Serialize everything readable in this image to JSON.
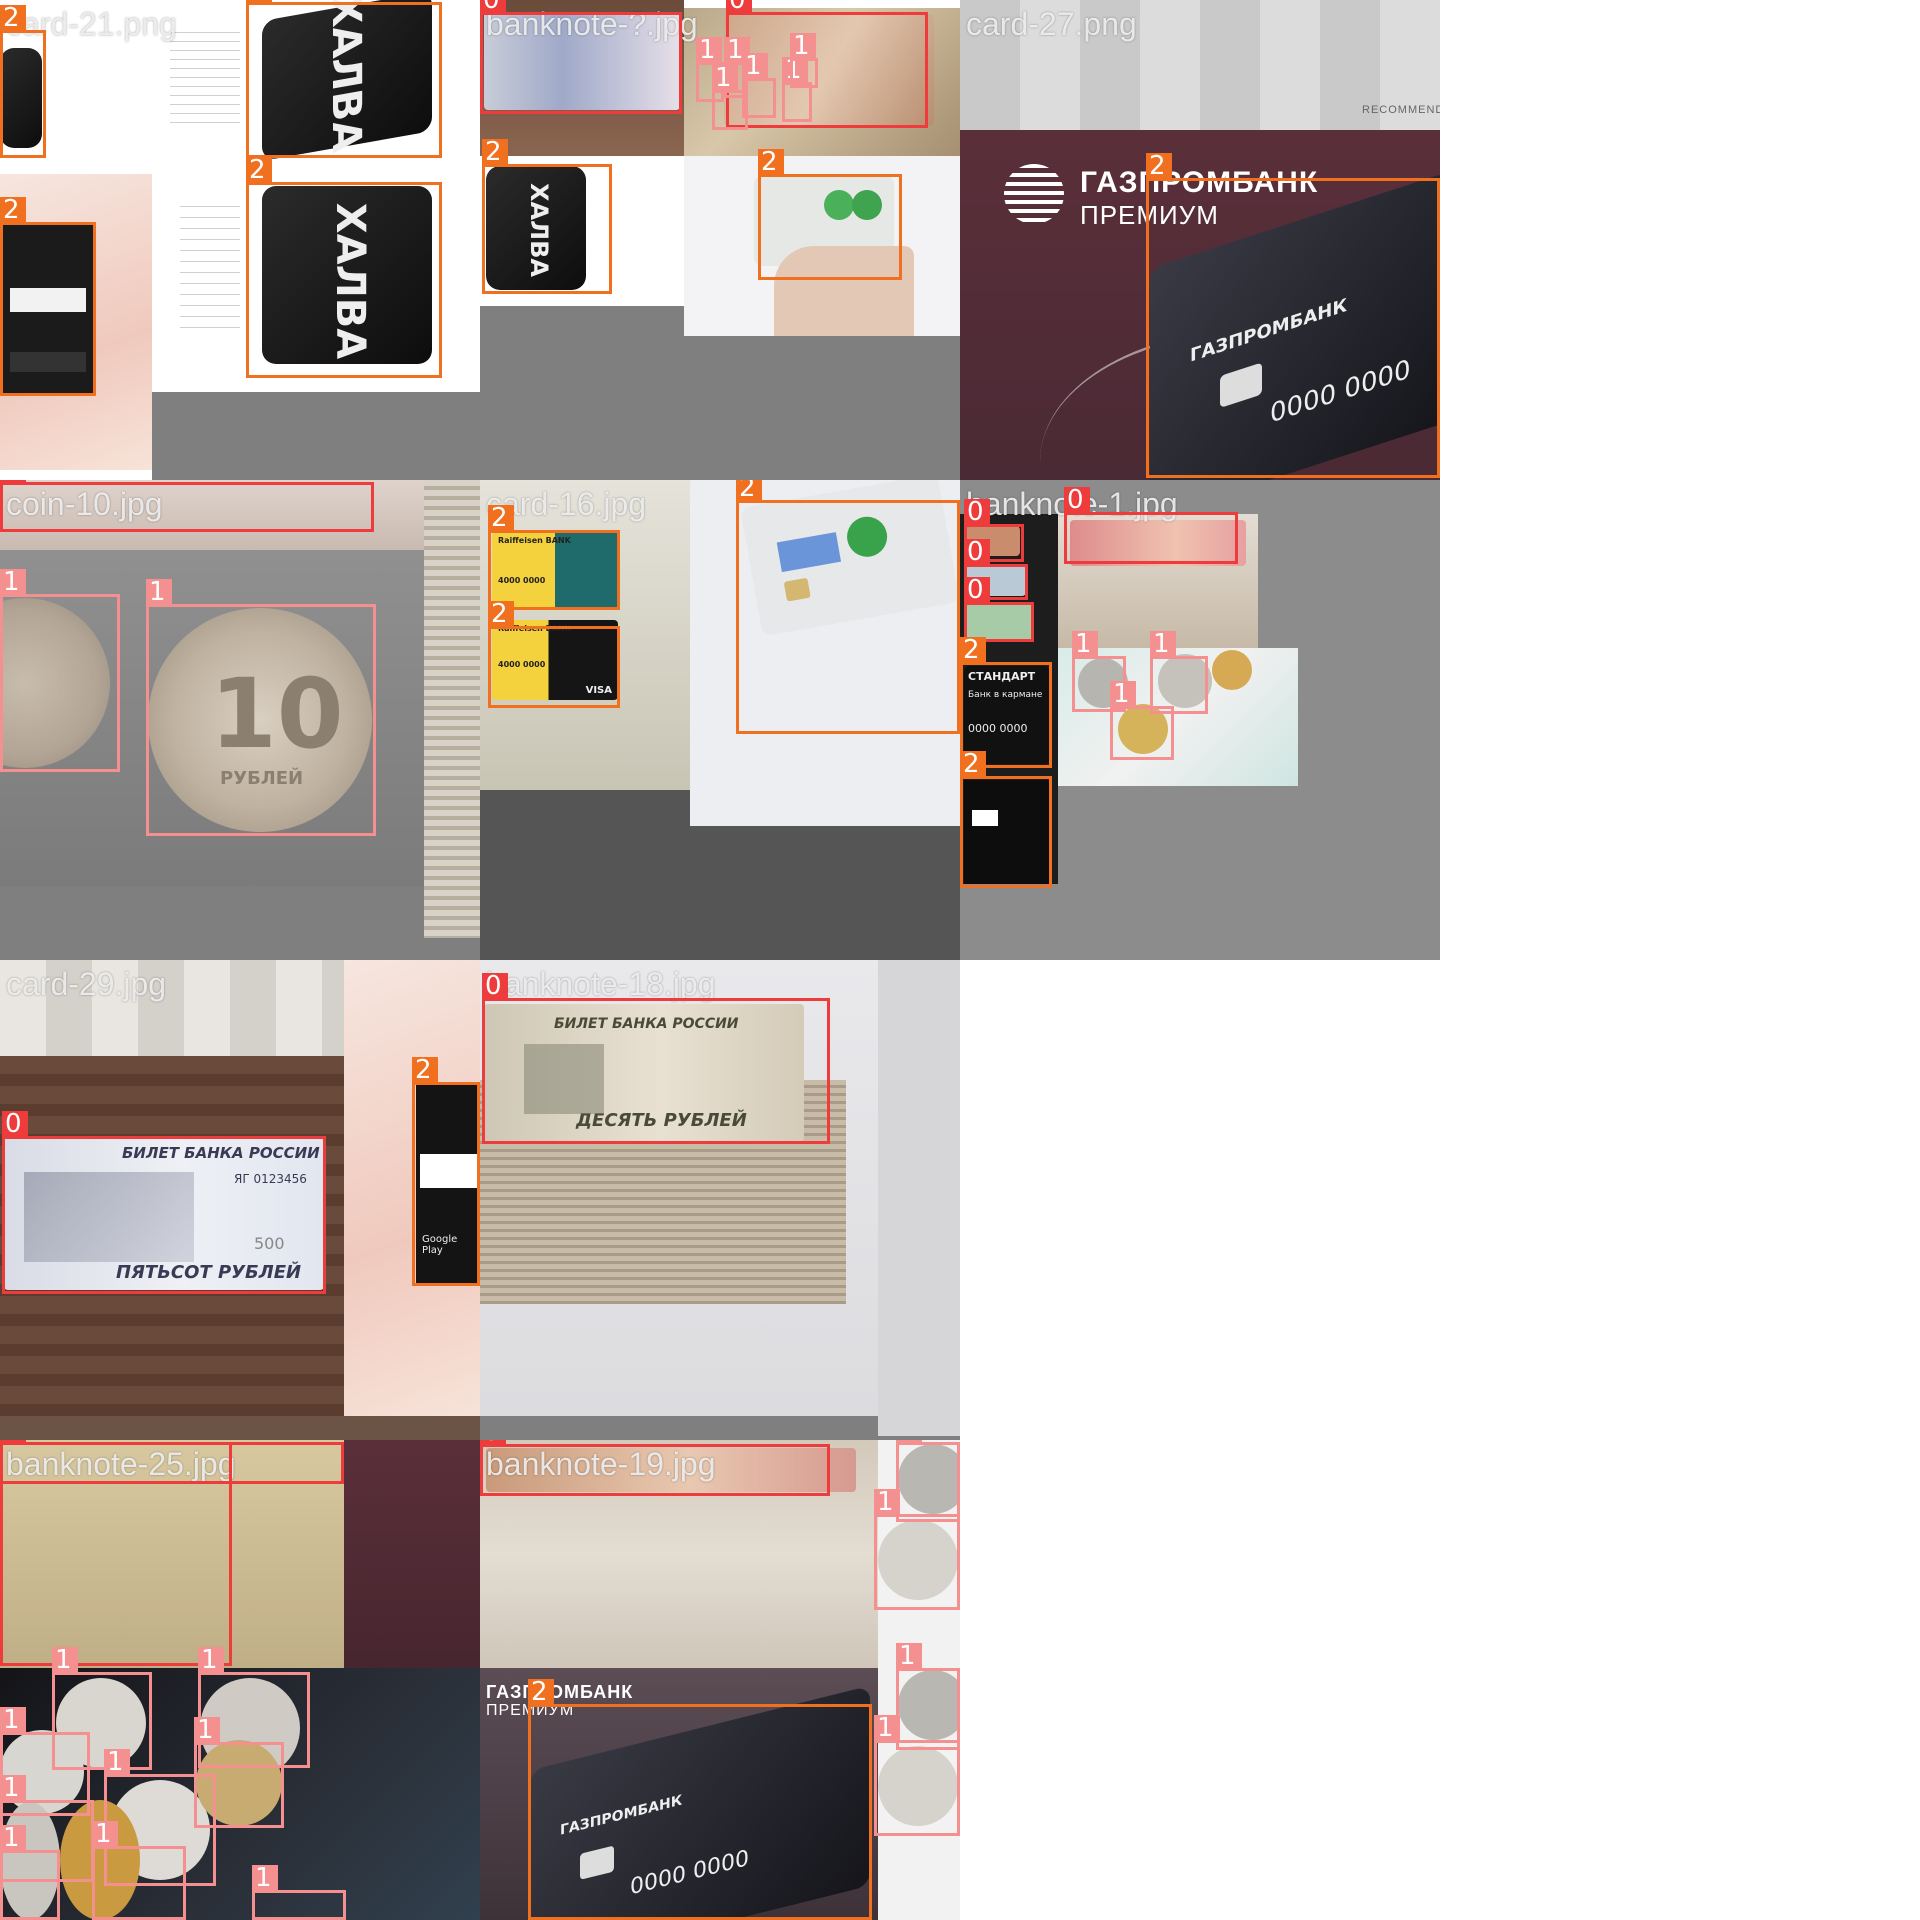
{
  "mosaic": {
    "tiles": [
      {
        "id": "t1",
        "label": "card-21.png"
      },
      {
        "id": "t2",
        "label": "banknote-?.jpg"
      },
      {
        "id": "t3",
        "label": "card-27.png"
      },
      {
        "id": "t4",
        "label": "coin-10.jpg"
      },
      {
        "id": "t5",
        "label": "card-16.jpg"
      },
      {
        "id": "t6",
        "label": "banknote-1.jpg"
      },
      {
        "id": "t7",
        "label": "card-29.jpg"
      },
      {
        "id": "t8",
        "label": "banknote-18.jpg"
      },
      {
        "id": "t9",
        "label": "banknote-25.jpg"
      },
      {
        "id": "t10",
        "label": "banknote-19.jpg"
      }
    ],
    "class_colors": {
      "0": "#ee3b3b",
      "1": "#f4908f",
      "2": "#f07020"
    },
    "texts": {
      "gazprom_logo": "ГАЗПРОМБАНК",
      "gazprom_sub": "ПРЕМИУМ",
      "gazprom_card": "ГАЗПРОМБАНК",
      "card_digits": "0000 0000",
      "card_digits2": "0000 0000",
      "note_title": "БИЛЕТ БАНКА РОССИИ",
      "note_serial": "ЯГ 0123456",
      "note_value": "ПЯТЬСОТ РУБЛЕЙ",
      "note_denom": "500",
      "note18_title": "БИЛЕТ БАНКА РОССИИ",
      "note18_value": "ДЕСЯТЬ РУБЛЕЙ",
      "coin_text": "10",
      "coin_sub": "РУБЛЕЙ",
      "standart_title": "СТАНДАРТ",
      "standart_sub": "Банк в кармане",
      "raif_bank": "Raiffeisen BANK",
      "raif_digits": "4000 0000",
      "visa": "VISA",
      "halva": "ХАЛВА",
      "google_play": "Google Play",
      "recommend": "RECOMMEND"
    }
  }
}
